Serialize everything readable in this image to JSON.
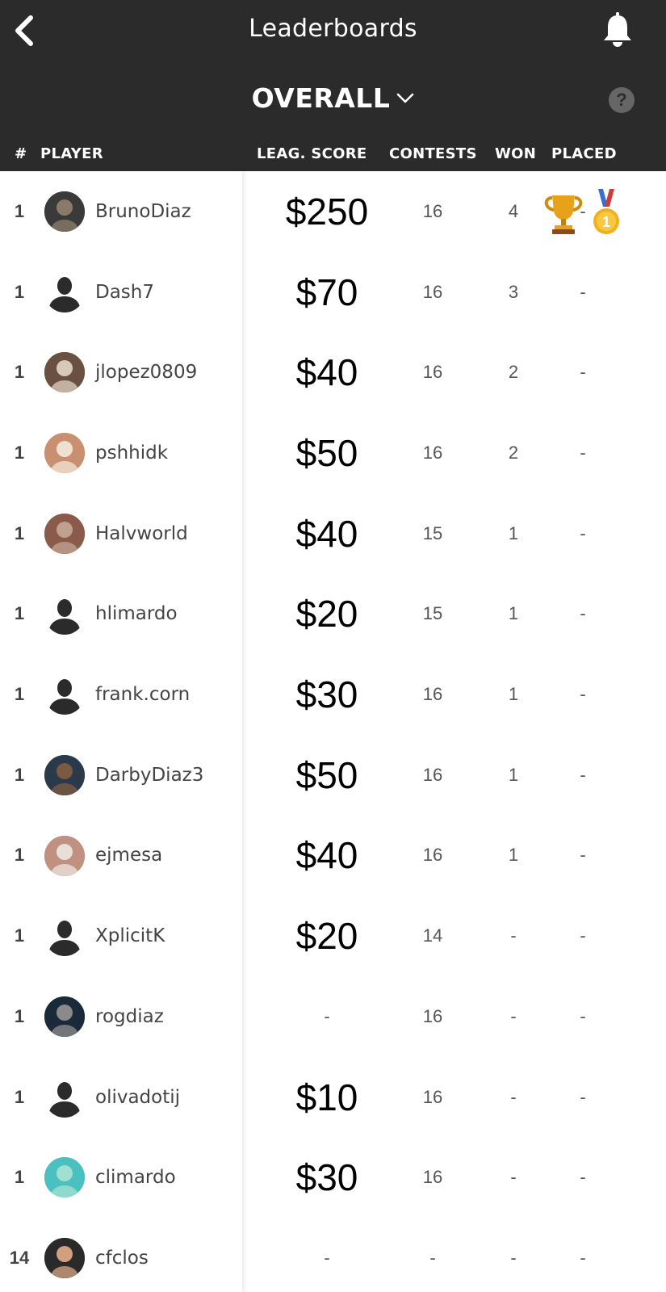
{
  "header": {
    "title": "Leaderboards",
    "selector_label": "OVERALL",
    "help_label": "?",
    "back_icon": "chevron-left-icon",
    "bell_icon": "bell-icon"
  },
  "columns": {
    "rank": "#",
    "player": "PLAYER",
    "score": "LEAG. SCORE",
    "contests": "CONTESTS",
    "won": "WON",
    "placed": "PLACED"
  },
  "rows": [
    {
      "rank": "1",
      "name": "BrunoDiaz",
      "score": "$250",
      "contests": "16",
      "won": "4",
      "placed": "-",
      "avatar": "photo",
      "badges": [
        "trophy-icon",
        "gold-medal-icon"
      ]
    },
    {
      "rank": "1",
      "name": "Dash7",
      "score": "$70",
      "contests": "16",
      "won": "3",
      "placed": "-",
      "avatar": "default"
    },
    {
      "rank": "1",
      "name": "jlopez0809",
      "score": "$40",
      "contests": "16",
      "won": "2",
      "placed": "-",
      "avatar": "photo"
    },
    {
      "rank": "1",
      "name": "pshhidk",
      "score": "$50",
      "contests": "16",
      "won": "2",
      "placed": "-",
      "avatar": "photo"
    },
    {
      "rank": "1",
      "name": "Halvworld",
      "score": "$40",
      "contests": "15",
      "won": "1",
      "placed": "-",
      "avatar": "photo"
    },
    {
      "rank": "1",
      "name": "hlimardo",
      "score": "$20",
      "contests": "15",
      "won": "1",
      "placed": "-",
      "avatar": "default"
    },
    {
      "rank": "1",
      "name": "frank.corn",
      "score": "$30",
      "contests": "16",
      "won": "1",
      "placed": "-",
      "avatar": "default"
    },
    {
      "rank": "1",
      "name": "DarbyDiaz3",
      "score": "$50",
      "contests": "16",
      "won": "1",
      "placed": "-",
      "avatar": "photo"
    },
    {
      "rank": "1",
      "name": "ejmesa",
      "score": "$40",
      "contests": "16",
      "won": "1",
      "placed": "-",
      "avatar": "photo"
    },
    {
      "rank": "1",
      "name": "XplicitK",
      "score": "$20",
      "contests": "14",
      "won": "-",
      "placed": "-",
      "avatar": "default"
    },
    {
      "rank": "1",
      "name": "rogdiaz",
      "score": "-",
      "contests": "16",
      "won": "-",
      "placed": "-",
      "avatar": "photo"
    },
    {
      "rank": "1",
      "name": "olivadotij",
      "score": "$10",
      "contests": "16",
      "won": "-",
      "placed": "-",
      "avatar": "default"
    },
    {
      "rank": "1",
      "name": "climardo",
      "score": "$30",
      "contests": "16",
      "won": "-",
      "placed": "-",
      "avatar": "photo"
    },
    {
      "rank": "14",
      "name": "cfclos",
      "score": "-",
      "contests": "-",
      "won": "-",
      "placed": "-",
      "avatar": "photo"
    }
  ],
  "colors": {
    "header_bg": "#2b2b2b",
    "header_text": "#ffffff",
    "row_text": "#444444",
    "score_text": "#000000"
  }
}
